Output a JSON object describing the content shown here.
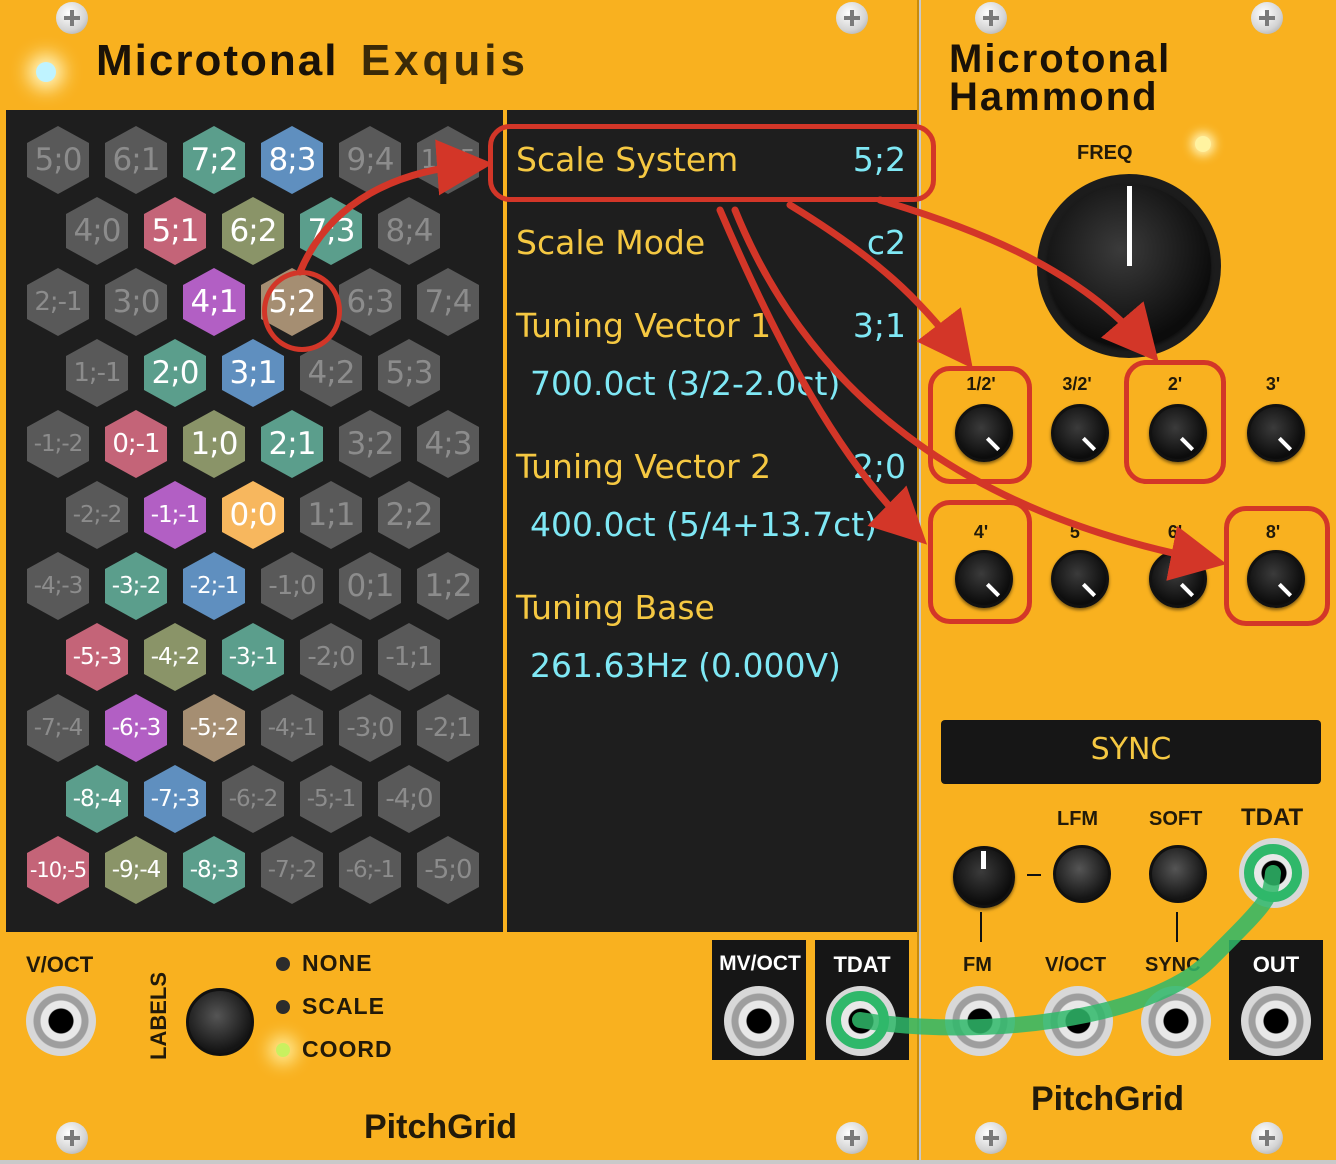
{
  "exquis": {
    "title_part1": "Microtonal",
    "title_part2": "Exquis",
    "brand": "PitchGrid",
    "display": {
      "scale_system_label": "Scale System",
      "scale_system_value": "5;2",
      "scale_mode_label": "Scale Mode",
      "scale_mode_value": "c2",
      "tv1_label": "Tuning Vector 1",
      "tv1_value": "3;1",
      "tv1_detail": "700.0ct (3/2-2.0ct)",
      "tv2_label": "Tuning Vector 2",
      "tv2_value": "2;0",
      "tv2_detail": "400.0ct (5/4+13.7ct)",
      "base_label": "Tuning Base",
      "base_detail": "261.63Hz (0.000V)"
    },
    "voct_label": "V/OCT",
    "labels_label": "LABELS",
    "options": [
      "NONE",
      "SCALE",
      "COORD"
    ],
    "selected_option": "COORD",
    "mvoct_label": "MV/OCT",
    "tdat_label": "TDAT",
    "grid": [
      [
        "5;0",
        "6;1",
        "7;2",
        "8;3",
        "9;4",
        "10;5"
      ],
      [
        "4;0",
        "5;1",
        "6;2",
        "7;3",
        "8;4"
      ],
      [
        "2;-1",
        "3;0",
        "4;1",
        "5;2",
        "6;3",
        "7;4"
      ],
      [
        "1;-1",
        "2;0",
        "3;1",
        "4;2",
        "5;3"
      ],
      [
        "-1;-2",
        "0;-1",
        "1;0",
        "2;1",
        "3;2",
        "4;3"
      ],
      [
        "-2;-2",
        "-1;-1",
        "0;0",
        "1;1",
        "2;2"
      ],
      [
        "-4;-3",
        "-3;-2",
        "-2;-1",
        "-1;0",
        "0;1",
        "1;2"
      ],
      [
        "-5;-3",
        "-4;-2",
        "-3;-1",
        "-2;0",
        "-1;1"
      ],
      [
        "-7;-4",
        "-6;-3",
        "-5;-2",
        "-4;-1",
        "-3;0",
        "-2;1"
      ],
      [
        "-8;-4",
        "-7;-3",
        "-6;-2",
        "-5;-1",
        "-4;0"
      ],
      [
        "-10;-5",
        "-9;-4",
        "-8;-3",
        "-7;-2",
        "-6;-1",
        "-5;0"
      ]
    ],
    "colors": {
      "teal": "#5b9e8c",
      "blue": "#5f8fbf",
      "pink": "#c46478",
      "olive": "#8a9468",
      "purple": "#b25fc4",
      "tan": "#a58e72",
      "orange": "#f7b75e",
      "gray": "#595959"
    }
  },
  "hammond": {
    "title_line1": "Microtonal",
    "title_line2": "Hammond",
    "brand": "PitchGrid",
    "freq_label": "FREQ",
    "drawbars_row1": [
      "1/2'",
      "3/2'",
      "2'",
      "3'"
    ],
    "drawbars_row2": [
      "4'",
      "5'",
      "6'",
      "8'"
    ],
    "sync_display": "SYNC",
    "lfm_label": "LFM",
    "soft_label": "SOFT",
    "tdat_label": "TDAT",
    "fm_label": "FM",
    "voct_label": "V/OCT",
    "sync_label": "SYNC",
    "out_label": "OUT"
  }
}
